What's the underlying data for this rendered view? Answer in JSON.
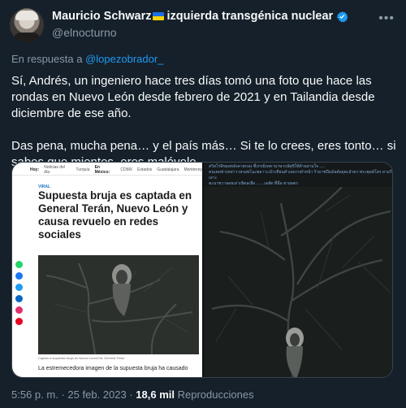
{
  "author": {
    "display_name": "Mauricio Schwarz",
    "display_name_suffix": "izquierda transgénica nuclear",
    "handle": "@elnocturno"
  },
  "reply": {
    "prefix": "En respuesta a",
    "mention": "@lopezobrador_"
  },
  "tweet": {
    "paragraph1": "Sí, Andrés, un ingeniero hace tres días tomó una foto que hace las rondas en Nuevo León desde febrero de 2021 y en Tailandia desde diciembre de ese año.",
    "paragraph2": "Das pena, mucha pena… y el país más… Si te lo crees, eres tonto… si sabes que mientes, eres malévolo…"
  },
  "media": {
    "left": {
      "nav": [
        "Hoy:",
        "Noticias del día",
        "Turquía",
        "En México:",
        "CDMX",
        "Estados",
        "Guadalajara",
        "Monterrey"
      ],
      "tag": "VIRAL",
      "headline": "Supuesta bruja es captada en General Terán, Nuevo León y causa revuelo en redes sociales",
      "caption": "Captan a supuesta bruja en Nuevo León/Vía: General Terán",
      "lead": "La estremecedora imagen de la supuesta bruja ha causado"
    },
    "right": {
      "line1": "สวิสโร่ลิขผลหลังคาตกลง ซึ่งกรมิเทคานาษากลัสุขิให้ด้ายสามใจ .....",
      "line2": "คนเคยช่างหล่าวาสรอพโนะพลาาะเบ้าเขียนดำเดยากดำหน้า ร้ามาชปีมมัลด์อยุตะอำดร พระพุดด์โสร  สามรีเอาะ",
      "line3": "ตะนาชวาอดยเล่าเขิดลเลือ ......  เดสัด ที่มี่ด  ฮายลตร"
    },
    "share_colors": [
      "#25d366",
      "#1877f2",
      "#1d9bf0",
      "#0a66c2",
      "#e1306c",
      "#e60023"
    ]
  },
  "footer": {
    "time": "5:56 p. m.",
    "separator": "·",
    "date": "25 feb. 2023",
    "views_count": "18,6 mil",
    "views_label": "Reproducciones"
  },
  "colors": {
    "background": "#15202b",
    "text": "#f7f9f9",
    "muted": "#8b98a5",
    "link": "#1d9bf0"
  }
}
